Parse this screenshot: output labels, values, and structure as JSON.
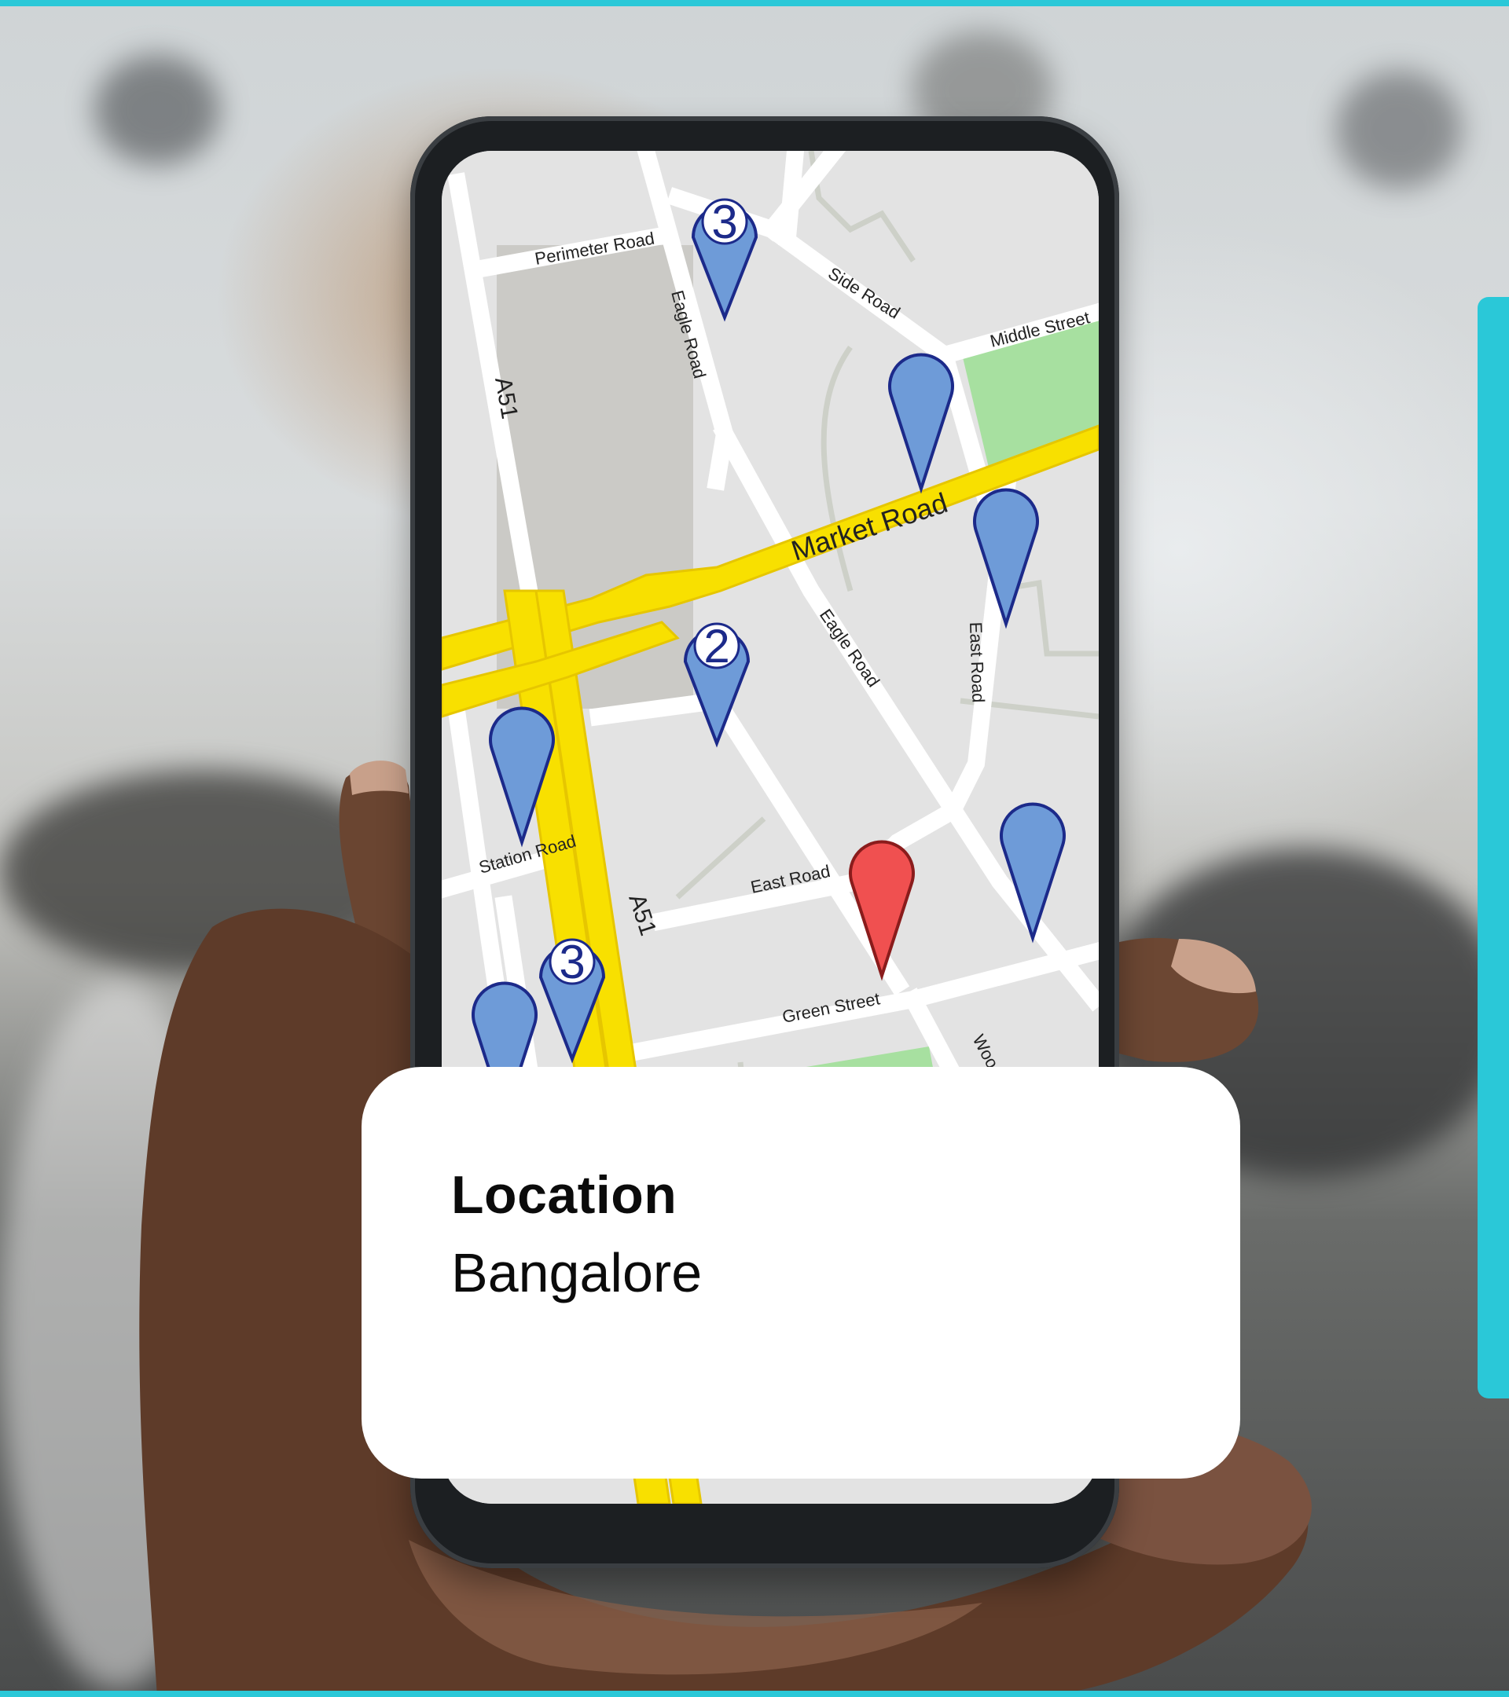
{
  "card": {
    "title": "Location",
    "value": "Bangalore"
  },
  "map": {
    "roads": {
      "perimeter": "Perimeter Road",
      "eagle_top": "Eagle Road",
      "side": "Side Road",
      "middle": "Middle Street",
      "a51_top": "A51",
      "market": "Market Road",
      "eagle_mid": "Eagle Road",
      "east_mid": "East Road",
      "station": "Station Road",
      "east_low": "East Road",
      "a51_low": "A51",
      "green": "Green Street",
      "wood": "Wood"
    },
    "pins": {
      "pin_3_top": "3",
      "pin_2": "2",
      "pin_3_low": "3"
    }
  },
  "colors": {
    "accent": "#2ac8d8",
    "pin_blue": "#6e9bd8",
    "pin_red": "#f05050",
    "road_yellow": "#f8e000",
    "park_green": "#a7e0a0"
  }
}
